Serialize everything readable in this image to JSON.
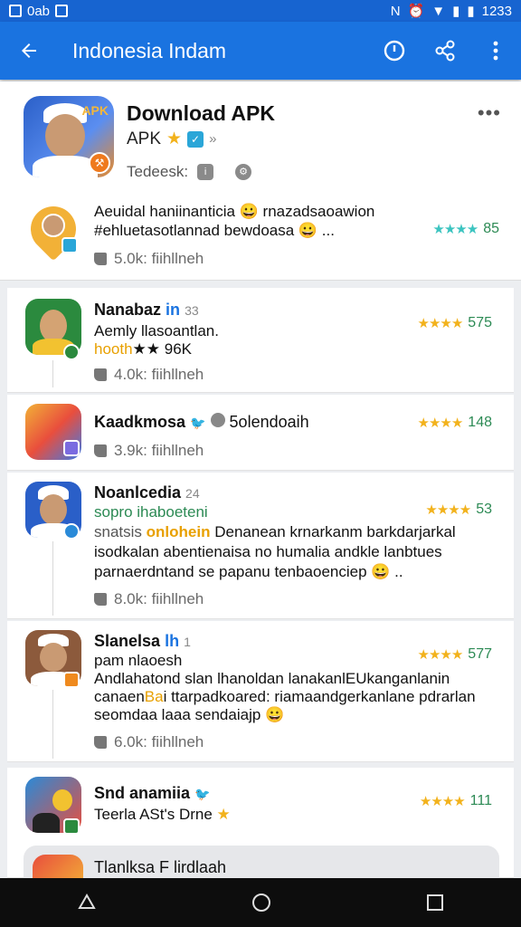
{
  "status_bar": {
    "left_text": "0ab",
    "time": "1233"
  },
  "app_bar": {
    "title": "Indonesia Indam"
  },
  "header": {
    "title": "Download APK",
    "subtitle": "APK",
    "subtitle_extra": "»",
    "developer": "Tedeesk:",
    "icon_tag": "APK"
  },
  "highlight": {
    "line1": "Aeuidal haniinanticia 😀 rnazadsaoawion",
    "line2": "#ehluetasotlannad bewdoasa 😀 ...",
    "meta": "5.0k: fiihllneh",
    "rating": "85"
  },
  "items": [
    {
      "name": "Nanabaz",
      "name_tag": "in",
      "name_extra": "33",
      "line1": "Aemly llasoantlan.",
      "line2_highlight": "hooth",
      "line2_rest": "★★ 96K",
      "meta": "4.0k: fiihllneh",
      "rating": "575"
    },
    {
      "name": "Kaadkmosa",
      "name_extra": "5olendoaih",
      "meta": "3.9k: fiihllneh",
      "rating": "148"
    },
    {
      "name": "Noanlcedia",
      "name_extra": "24",
      "line1": "sopro ihaboeteni",
      "line2_prefix": "snatsis",
      "line2_highlight": "onlohein",
      "line2_rest": "Denanean krnarkanm barkdarjarkal",
      "line3": "isodkalan abentienaisa no humalia andkle lanbtues",
      "line4": "parnaerdntand se papanu tenbaoenciep 😀 ..",
      "meta": "8.0k: fiihllneh",
      "rating": "53"
    },
    {
      "name": "Slanelsa",
      "name_tag": "lh",
      "name_extra": "1",
      "line1": "pam nlaoesh",
      "line2": "Andlahatond slan lhanoldan lanakanlEUkanganlanin",
      "line3_prefix": "canaen",
      "line3_highlight": "Ba",
      "line3_rest": "i ttarpadkoared: riamaandgerkanlane pdrarlan",
      "line4": "seomdaa laaa sendaiajp 😀",
      "meta": "6.0k: fiihllneh",
      "rating": "577"
    },
    {
      "name": "Snd anamiia",
      "line1": "Teerla ASt's Drne",
      "rating": "111"
    },
    {
      "name": "Tlanlksa F lirdlaah"
    }
  ],
  "colors": {
    "primary": "#1a73e0",
    "star": "#f2b21c",
    "rating_text": "#2c8a54"
  }
}
